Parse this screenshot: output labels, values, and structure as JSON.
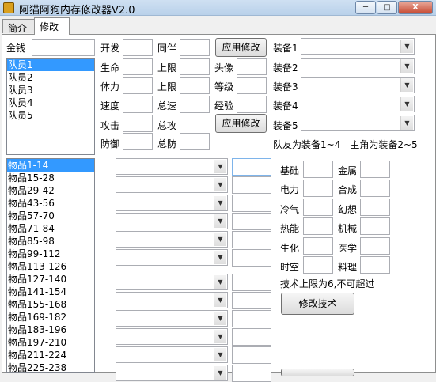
{
  "window": {
    "title": "阿猫阿狗内存修改器V2.0",
    "minimize": "─",
    "maximize": "□",
    "close": "X"
  },
  "tabs": [
    "简介",
    "修改"
  ],
  "money": {
    "label": "金钱",
    "value": ""
  },
  "members": [
    "队员1",
    "队员2",
    "队员3",
    "队员4",
    "队员5"
  ],
  "stats_col1": [
    "开发",
    "生命",
    "体力",
    "速度",
    "攻击",
    "防御"
  ],
  "stats_col2": [
    "同伴",
    "上限",
    "上限",
    "总速",
    "总攻",
    "总防"
  ],
  "stats_col3": [
    "头像",
    "等级",
    "经验"
  ],
  "apply_button": "应用修改",
  "equip_labels": [
    "装备1",
    "装备2",
    "装备3",
    "装备4",
    "装备5"
  ],
  "equip_note": "队友为装备1~4　主角为装备2~5",
  "items": [
    "物品1-14",
    "物品15-28",
    "物品29-42",
    "物品43-56",
    "物品57-70",
    "物品71-84",
    "物品85-98",
    "物品99-112",
    "物品113-126",
    "物品127-140",
    "物品141-154",
    "物品155-168",
    "物品169-182",
    "物品183-196",
    "物品197-210",
    "物品211-224",
    "物品225-238"
  ],
  "skills_left": [
    "基础",
    "电力",
    "冷气",
    "热能",
    "生化",
    "时空"
  ],
  "skills_right": [
    "金属",
    "合成",
    "幻想",
    "机械",
    "医学",
    "料理"
  ],
  "skill_note": "技术上限为6,不可超过",
  "skill_button": "修改技术"
}
